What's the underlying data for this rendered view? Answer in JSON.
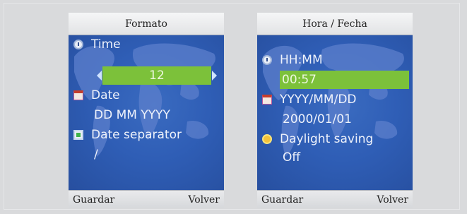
{
  "colors": {
    "background": "#d9dadc",
    "map_blue": "#2f5eb6",
    "highlight_green": "#7cc13a",
    "bar_gray": "#e2e3e5"
  },
  "screen1": {
    "title": "Formato",
    "rows": {
      "time_label": "Time",
      "time_value": "12",
      "date_label": "Date",
      "date_value": "DD MM YYYY",
      "separator_label": "Date separator",
      "separator_value": "/"
    },
    "softkeys": {
      "left": "Guardar",
      "right": "Volver"
    }
  },
  "screen2": {
    "title": "Hora / Fecha",
    "rows": {
      "time_format": "HH:MM",
      "time_value": "00:57",
      "date_format": "YYYY/MM/DD",
      "date_value": "2000/01/01",
      "daylight_label": "Daylight saving",
      "daylight_value": "Off"
    },
    "softkeys": {
      "left": "Guardar",
      "right": "Volver"
    }
  },
  "icons": {
    "time": "clock-icon",
    "date": "calendar-icon",
    "separator": "date-separator-icon",
    "daylight": "sun-icon"
  }
}
